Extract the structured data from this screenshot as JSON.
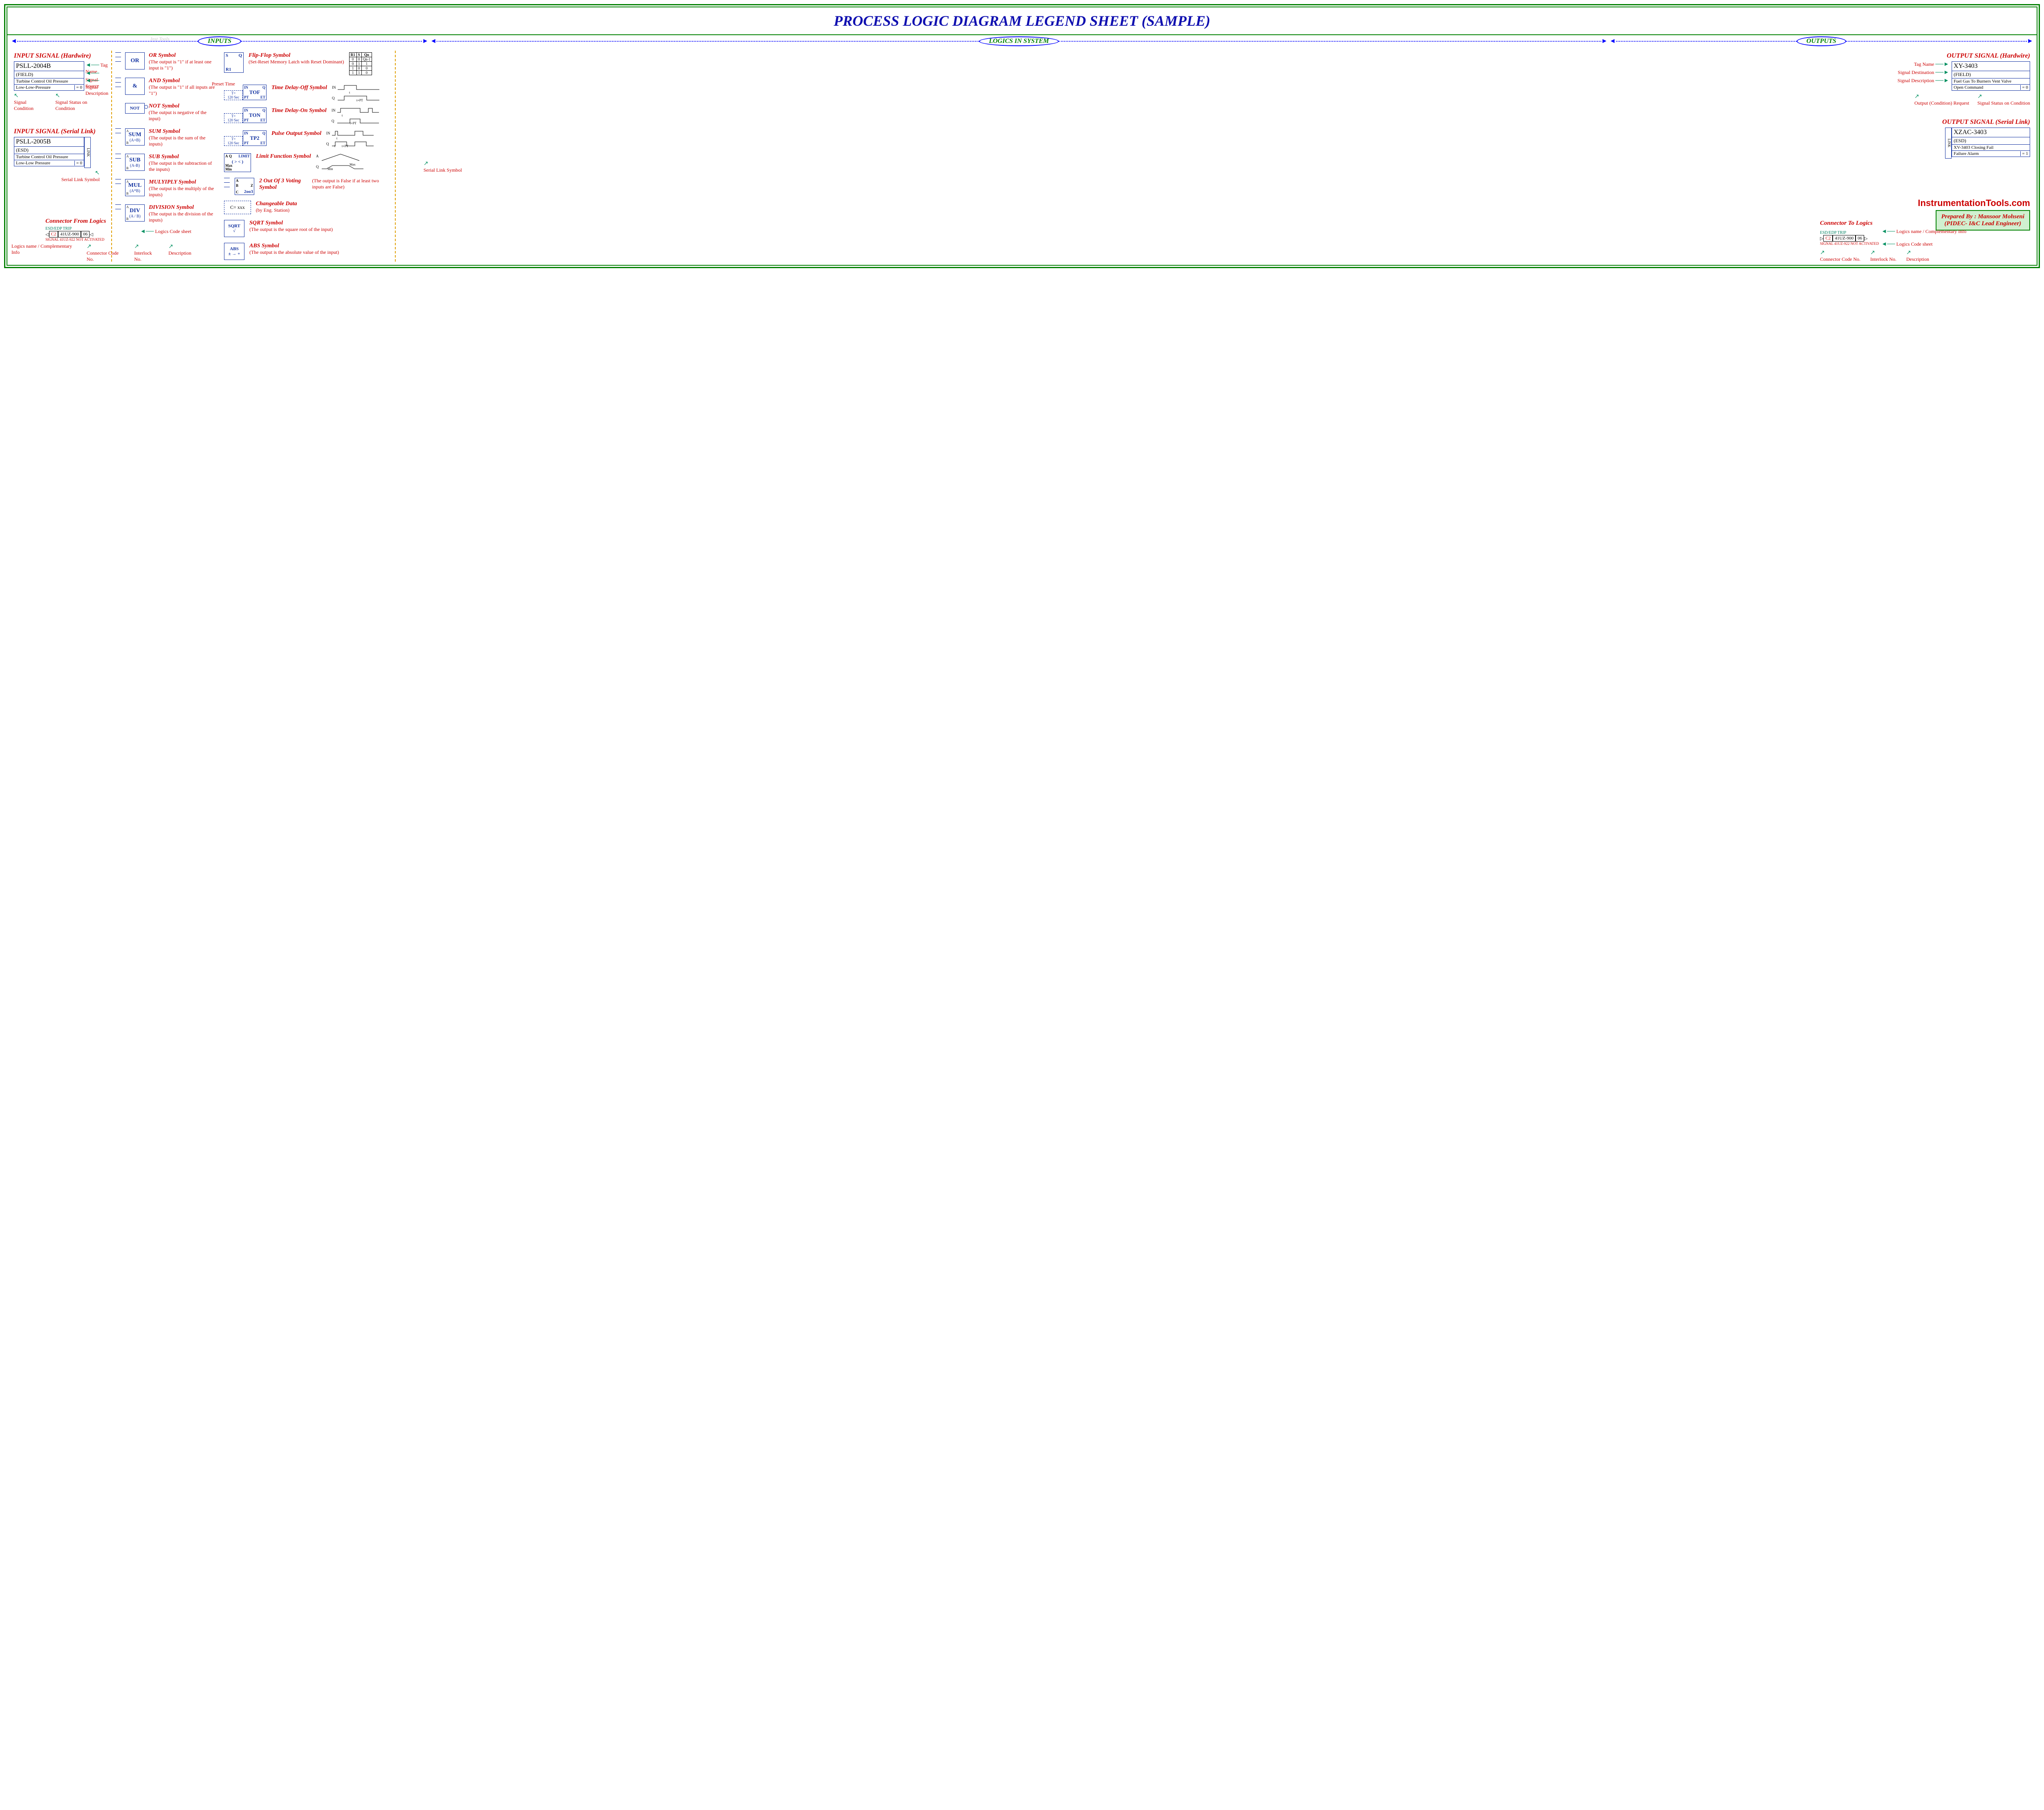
{
  "title": "PROCESS LOGIC DIAGRAM LEGEND SHEET    (SAMPLE)",
  "watermark": "Inst Tools",
  "sections": {
    "inputs": "INPUTS",
    "logics": "LOGICS IN SYSTEM",
    "outputs": "OUTPUTS"
  },
  "inputs": {
    "hardwire": {
      "header": "INPUT SIGNAL (Hardwire)",
      "tag": "PSLL-2004B",
      "source": "(FIELD)",
      "desc": "Turbine Control Oil Pressure",
      "cond": "Low-Low-Pressure",
      "status": "= 0",
      "labels": {
        "tag": "Tag Name",
        "source": "Signal Source",
        "desc": "Signal Description",
        "cond": "Signal Condition",
        "status": "Signal Status on Condition"
      }
    },
    "serial": {
      "header": "INPUT SIGNAL (Serial Link)",
      "tag": "PSLL-2005B",
      "source": "(ESD)",
      "desc": "Turbine Control Oil Pressure",
      "cond": "Low-Low Pressure",
      "status": "= 0",
      "link": "LINK",
      "label": "Serial Link Symbol"
    }
  },
  "outputs": {
    "hardwire": {
      "header": "OUTPUT SIGNAL (Hardwire)",
      "tag": "XY-3403",
      "dest": "(FIELD)",
      "desc": "Fuel Gas To Burners Vent Valve",
      "cond": "Open Command",
      "status": "= 0",
      "labels": {
        "tag": "Tag Name",
        "dest": "Signal Destination",
        "desc": "Signal Description",
        "cond": "Output (Condition) Request",
        "status": "Signal Status on Condition"
      }
    },
    "serial": {
      "header": "OUTPUT SIGNAL (Serial Link)",
      "tag": "XZAC-3403",
      "dest": "(ESD)",
      "desc": "XV-3403 Closing Fail",
      "cond": "Failure Alarm",
      "status": "= 1",
      "link": "LINK",
      "label": "Serial Link Symbol"
    }
  },
  "ops": {
    "or": {
      "sym": "OR",
      "name": "OR Symbol",
      "text": "(The output is \"1\" if at least one input is \"1\")"
    },
    "and": {
      "sym": "&",
      "name": "AND Symbol",
      "text": "(The output is \"1\" if all inputs are \"1\")"
    },
    "not": {
      "sym": "NOT",
      "name": "NOT Symbol",
      "text": "(The output is negative of the input)"
    },
    "sum": {
      "sym": "SUM",
      "sub": "(A+B)",
      "name": "SUM Symbol",
      "text": "(The output is the sum of the inputs)"
    },
    "sub": {
      "sym": "SUB",
      "sub": "(A-B)",
      "name": "SUB Symbol",
      "text": "(The output is the subtraction of the inputs)"
    },
    "mul": {
      "sym": "MUL",
      "sub": "(A*B)",
      "name": "MULYIPLY Symbol",
      "text": "(The output is the multiply of the inputs)"
    },
    "div": {
      "sym": "DIV",
      "sub": "(A / B)",
      "name": "DIVISION Symbol",
      "text": "(The output is the division of the inputs)"
    }
  },
  "mid": {
    "preset_label": "Preset Time",
    "preset_value_top": "T=",
    "preset_value_bot": "120 Sec",
    "ff": {
      "s": "S",
      "q": "Q",
      "r": "R1",
      "name": "Flip-Flop Symbol",
      "text": "(Set-Reset Memory Latch with Reset Dominant)",
      "truth": {
        "h": [
          "R1",
          "S",
          "Qn"
        ],
        "r": [
          [
            "0",
            "0",
            "Qn-1"
          ],
          [
            "0",
            "1",
            "1"
          ],
          [
            "1",
            "0",
            "0"
          ],
          [
            "1",
            "1",
            "0"
          ]
        ]
      }
    },
    "tof": {
      "sym": "TOF",
      "name": "Time Delay-Off Symbol",
      "pins": [
        "IN",
        "Q",
        "PT",
        "ET"
      ],
      "wave": {
        "in": "IN",
        "q": "Q",
        "t": "t",
        "tpt": "t+PT"
      }
    },
    "ton": {
      "sym": "TON",
      "name": "Time Delay-On Symbol",
      "pins": [
        "IN",
        "Q",
        "PT",
        "ET"
      ],
      "wave": {
        "in": "IN",
        "q": "Q",
        "t": "t",
        "tpt": "t+PT"
      }
    },
    "tp2": {
      "sym": "TP2",
      "name": "Pulse Output Symbol",
      "pins": [
        "IN",
        "Q",
        "PT",
        "ET"
      ],
      "wave": {
        "in": "IN",
        "q": "Q",
        "t": "t",
        "tpt": "t+PT"
      }
    },
    "limit": {
      "sym": "LIMIT",
      "op": "( > < )",
      "a": "A",
      "q": "Q",
      "max": "Max",
      "min": "Min",
      "name": "Limit Function Symbol",
      "wave": {
        "a": "A",
        "q": "Q",
        "min": "Min",
        "max": "Max"
      }
    },
    "vote": {
      "sym": "2oo3",
      "a": "A",
      "b": "B",
      "c": "C",
      "z": "Z",
      "name": "2 Out Of 3 Voting Symbol",
      "text": "(The output is False if at least two inputs are False)"
    },
    "change": {
      "sym": "C= xxx",
      "name": "Changeable Data",
      "text": "(by Eng. Station)"
    },
    "sqrt": {
      "sym": "SQRT",
      "glyph": "√",
      "name": "SQRT Symbol",
      "text": "(The output is the square root of the input)"
    },
    "abs": {
      "sym": "ABS",
      "glyph": "± → +",
      "name": "ABS Symbol",
      "text": "(The output is the absolute value of the input)"
    }
  },
  "connectors": {
    "from": {
      "header": "Connector From Logics",
      "top": "ESD/EDP TRIP",
      "c2": "C2",
      "il": "41UZ-900",
      "sheet": "06",
      "bot": "SIGNAL 41UZ-922 NOT ACTIVATED",
      "labels": {
        "info": "Logics name / Complementary Info",
        "c2": "Connector Code No.",
        "il": "Interlock No.",
        "desc": "Description",
        "sheet": "Logics Code sheet"
      }
    },
    "to": {
      "header": "Connector To Logics",
      "top": "ESD/EDP TRIP",
      "c2": "C2",
      "il": "41UZ-900",
      "sheet": "06",
      "bot": "SIGNAL 41UZ-922 NOT ACTIVATED",
      "labels": {
        "info": "Logics name / Complementary Info",
        "c2": "Connector Code No.",
        "il": "Interlock No.",
        "desc": "Description",
        "sheet": "Logics Code sheet"
      }
    }
  },
  "credit": "InstrumentationTools.com",
  "prepared": {
    "l1": "Prepared By : Mansoor Mohseni",
    "l2": "(PIDEC- I&C Lead Engineer)"
  }
}
